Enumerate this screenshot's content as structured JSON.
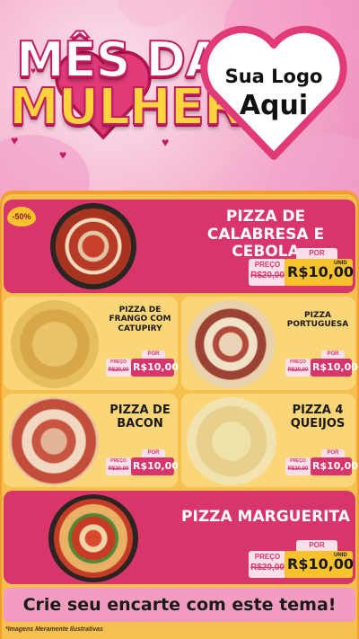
{
  "header": {
    "title_line1": "MÊS DA",
    "title_line2": "MULHER",
    "logo_line1": "Sua Logo",
    "logo_line2": "Aqui"
  },
  "featured": [
    {
      "name": "PIZZA DE CALABRESA E CEBOLA",
      "badge": "-50%",
      "preco_label": "PREÇO",
      "old_price": "R$20,00",
      "por_label": "POR",
      "price": "R$10,00",
      "unit": "UNID"
    },
    {
      "name": "PIZZA MARGUERITA",
      "preco_label": "PREÇO",
      "old_price": "R$20,00",
      "por_label": "POR",
      "price": "R$10,00",
      "unit": "UNID"
    }
  ],
  "grid": [
    {
      "name": "PIZZA DE FRANGO COM CATUPIRY",
      "preco_label": "PREÇO",
      "old_price": "R$20,00",
      "por_label": "POR",
      "price": "R$10,00"
    },
    {
      "name": "PIZZA PORTUGUESA",
      "preco_label": "PREÇO",
      "old_price": "R$20,00",
      "por_label": "POR",
      "price": "R$10,00"
    },
    {
      "name": "PIZZA DE BACON",
      "preco_label": "PREÇO",
      "old_price": "R$20,00",
      "por_label": "POR",
      "price": "R$10,00"
    },
    {
      "name": "PIZZA 4 QUEIJOS",
      "preco_label": "PREÇO",
      "old_price": "R$20,00",
      "por_label": "POR",
      "price": "R$10,00"
    }
  ],
  "cta": "Crie seu encarte com este tema!",
  "footnote": "*Imagens Meramente Ilustrativas",
  "colors": {
    "pink": "#d8356b",
    "yellow": "#f7c22b",
    "orange": "#f29e2e",
    "light_card": "#fad678"
  }
}
